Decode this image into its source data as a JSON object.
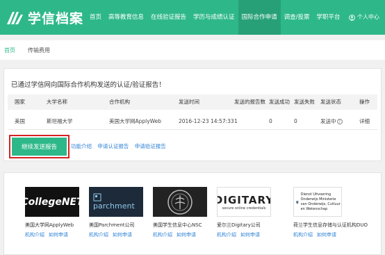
{
  "header": {
    "logo_text": "学信档案",
    "nav": [
      "首页",
      "高等教育信息",
      "在线验证报告",
      "学历与成绩认证",
      "国际合作申请",
      "调查/投票",
      "学职平台"
    ],
    "active_index": 4,
    "user": "个人中心"
  },
  "breadcrumb": {
    "home": "首页",
    "current": "传输费用"
  },
  "main": {
    "notice": "已通过学信网向国际合作机构发送的认证/验证报告！",
    "table": {
      "headers": [
        "国家",
        "大学名称",
        "合作机构",
        "发送时间",
        "发送的报告数",
        "发送成功",
        "发送失败",
        "发送状态",
        "操作"
      ],
      "row": {
        "country": "美国",
        "university": "斯坦福大学",
        "agency": "美国大学网ApplyWeb",
        "time": "2016-12-23 14:57:33",
        "count": "1",
        "success": "0",
        "fail": "0",
        "status": "发送中",
        "action": "详细"
      }
    },
    "continue_button": "继续发送报告",
    "links": [
      "功能介绍",
      "申请认证报告",
      "申请验证报告"
    ]
  },
  "partners": [
    {
      "logo_text": "CollegeNET",
      "name": "美国大学网ApplyWeb",
      "links": [
        "机构介绍",
        "如何申请"
      ]
    },
    {
      "logo_text": "parchment",
      "name": "美国Parchment公司",
      "links": [
        "机构介绍",
        "如何申请"
      ]
    },
    {
      "logo_text": "",
      "name": "美国学生信息中心NSC",
      "links": [
        "机构介绍",
        "如何申请"
      ]
    },
    {
      "logo_text": "DIGITARY",
      "logo_sub": "secure online credentials",
      "name": "爱尔兰Digitary公司",
      "links": [
        "机构介绍",
        "如何申请"
      ]
    },
    {
      "logo_text": "Dienst Uitvoering Onderwijs Ministerie van Onderwijs, Cultuur en Wetenschap",
      "name": "荷兰学生信息存储与认证机构DUO",
      "links": [
        "机构介绍",
        "如何申请"
      ]
    }
  ],
  "colors": {
    "brand": "#2eb88a",
    "link": "#2a7fd4",
    "highlight": "#d62222"
  }
}
